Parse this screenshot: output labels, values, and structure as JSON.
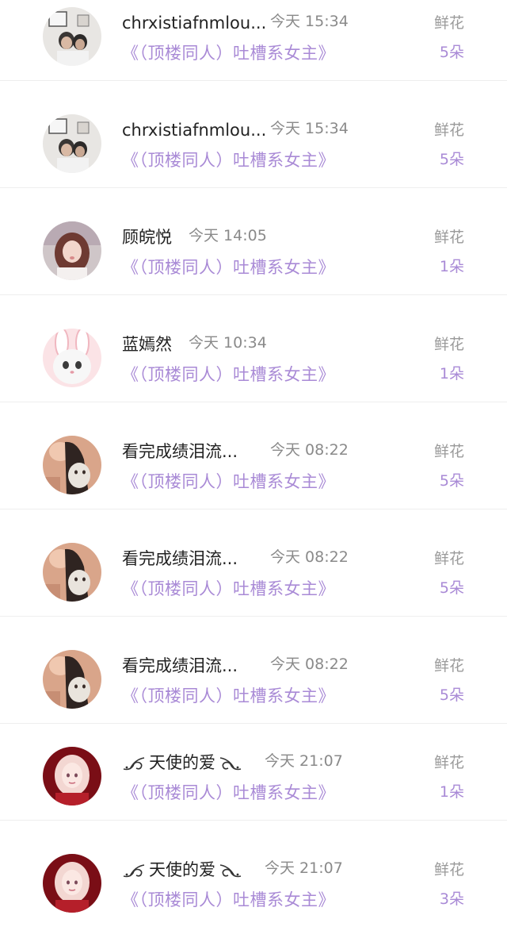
{
  "rows": [
    {
      "name": "chrxistiafnmlou...",
      "time": "今天 15:34",
      "book": "《（顶楼同人）吐槽系女主》",
      "gift_label": "鲜花",
      "gift_count": "5朵",
      "avatar": "couple-photo"
    },
    {
      "name": "chrxistiafnmlou...",
      "time": "今天 15:34",
      "book": "《（顶楼同人）吐槽系女主》",
      "gift_label": "鲜花",
      "gift_count": "5朵",
      "avatar": "couple-photo"
    },
    {
      "name": "顾皖悦",
      "time": "今天 14:05",
      "book": "《（顶楼同人）吐槽系女主》",
      "gift_label": "鲜花",
      "gift_count": "1朵",
      "avatar": "girl-portrait"
    },
    {
      "name": "蓝嫣然",
      "time": "今天 10:34",
      "book": "《（顶楼同人）吐槽系女主》",
      "gift_label": "鲜花",
      "gift_count": "1朵",
      "avatar": "bunny-cat"
    },
    {
      "name": "看完成绩泪流...",
      "time": "今天 08:22",
      "book": "《（顶楼同人）吐槽系女主》",
      "gift_label": "鲜花",
      "gift_count": "5朵",
      "avatar": "girl-with-rabbit"
    },
    {
      "name": "看完成绩泪流...",
      "time": "今天 08:22",
      "book": "《（顶楼同人）吐槽系女主》",
      "gift_label": "鲜花",
      "gift_count": "5朵",
      "avatar": "girl-with-rabbit"
    },
    {
      "name": "看完成绩泪流...",
      "time": "今天 08:22",
      "book": "《（顶楼同人）吐槽系女主》",
      "gift_label": "鲜花",
      "gift_count": "5朵",
      "avatar": "girl-with-rabbit"
    },
    {
      "name": "天使的爱",
      "time": "今天 21:07",
      "book": "《（顶楼同人）吐槽系女主》",
      "gift_label": "鲜花",
      "gift_count": "1朵",
      "avatar": "anime-angel"
    },
    {
      "name": "天使的爱",
      "time": "今天 21:07",
      "book": "《（顶楼同人）吐槽系女主》",
      "gift_label": "鲜花",
      "gift_count": "3朵",
      "avatar": "anime-angel"
    }
  ],
  "colors": {
    "accent": "#a98ad6",
    "name": "#222222",
    "meta": "#8a8a8a",
    "divider": "#eeeeee"
  }
}
